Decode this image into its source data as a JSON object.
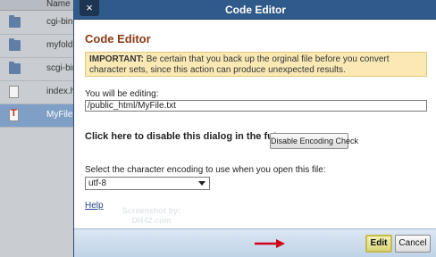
{
  "background": {
    "column_header": "Name",
    "files": [
      {
        "name": "cgi-bin",
        "icon": "folder-icon",
        "selected": false
      },
      {
        "name": "myfolder",
        "icon": "folder-icon",
        "selected": false
      },
      {
        "name": "scgi-bin",
        "icon": "folder-icon",
        "selected": false
      },
      {
        "name": "index.html",
        "icon": "html-file-icon",
        "selected": false
      },
      {
        "name": "MyFile.txt",
        "icon": "text-file-icon",
        "selected": true
      }
    ]
  },
  "dialog": {
    "title": "Code Editor",
    "close_label": "×",
    "heading": "Code Editor",
    "warning_strong": "IMPORTANT:",
    "warning_text": " Be certain that you back up the orginal file before you convert character sets, since this action can produce unexpected results.",
    "editing_label": "You will be editing:",
    "editing_path": "/public_html/MyFile.txt",
    "disable_text": "Click here to disable this dialog in the future.",
    "disable_button": "Disable Encoding Check",
    "encoding_label": "Select the character encoding to use when you open this file:",
    "encoding_selected": "utf-8",
    "help_link": "Help",
    "edit_button": "Edit",
    "cancel_button": "Cancel",
    "watermark_line1": "Screenshot by:",
    "watermark_line2": "DH42.com"
  },
  "colors": {
    "titlebar": "#2f5a8a",
    "heading": "#8b3a15",
    "warning_bg": "#fbe9b5",
    "arrow": "#d0021b"
  }
}
